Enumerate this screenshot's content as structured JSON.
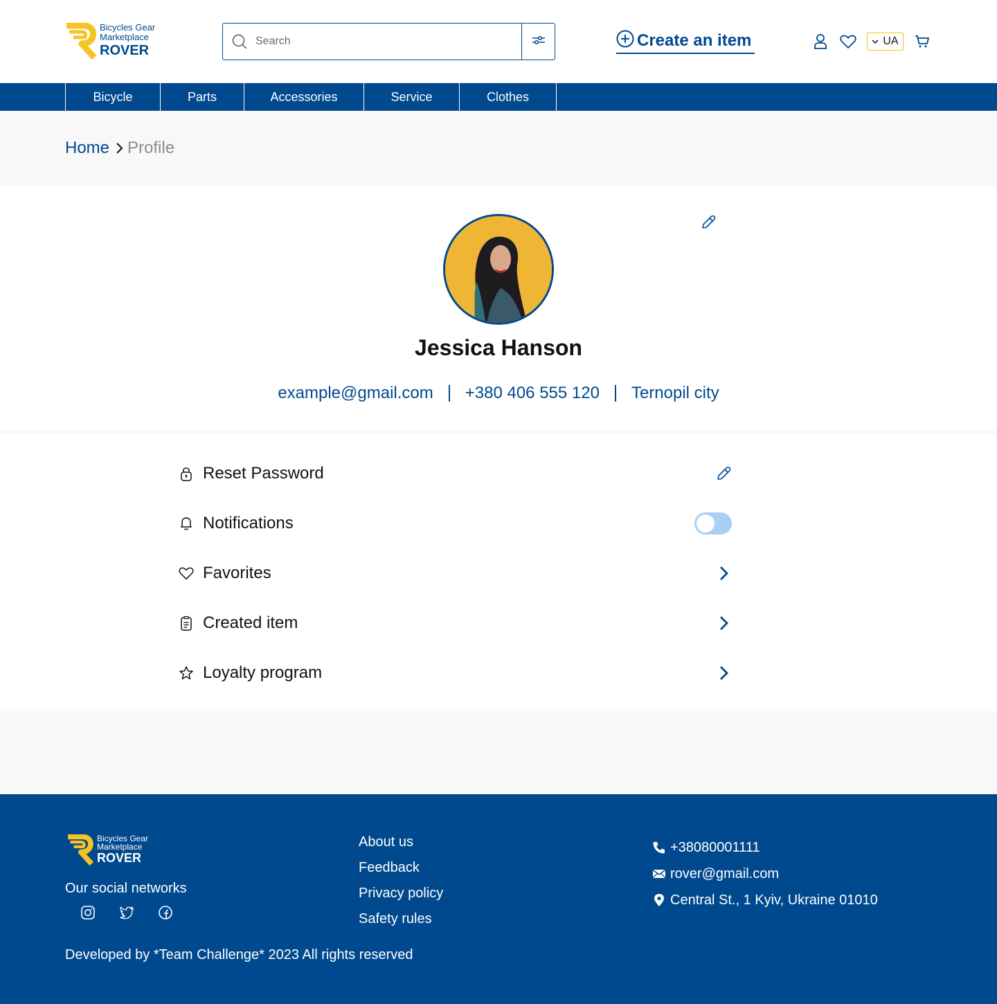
{
  "brand": {
    "subtitle_line1": "Bicycles Gear",
    "subtitle_line2": "Marketplace",
    "name": "ROVER",
    "colors": {
      "primary": "#00498f",
      "accent": "#f6c325"
    }
  },
  "search": {
    "placeholder": "Search"
  },
  "header": {
    "create_item_label": "Create an item",
    "language": "UA",
    "icons": [
      "user-icon",
      "heart-icon",
      "cart-icon"
    ]
  },
  "nav": {
    "items": [
      {
        "label": "Bicycle"
      },
      {
        "label": "Parts"
      },
      {
        "label": "Accessories"
      },
      {
        "label": "Service"
      },
      {
        "label": "Clothes"
      }
    ]
  },
  "breadcrumb": {
    "home": "Home",
    "current": "Profile"
  },
  "profile": {
    "name": "Jessica Hanson",
    "email": "example@gmail.com",
    "phone": "+380 406 555 120",
    "city": "Ternopil city"
  },
  "settings": {
    "reset_password": "Reset Password",
    "notifications": "Notifications",
    "notifications_enabled": false,
    "favorites": "Favorites",
    "created_item": "Created item",
    "loyalty_program": "Loyalty program"
  },
  "footer": {
    "social_title": "Our social networks",
    "links": {
      "about": "About us",
      "feedback": "Feedback",
      "privacy": "Privacy policy",
      "safety": "Safety rules"
    },
    "contacts": {
      "phone": "+38080001111",
      "email": "rover@gmail.com",
      "address": "Central St., 1 Kyiv, Ukraine 01010"
    },
    "copyright": "Developed by *Team Challenge* 2023 All rights reserved"
  }
}
